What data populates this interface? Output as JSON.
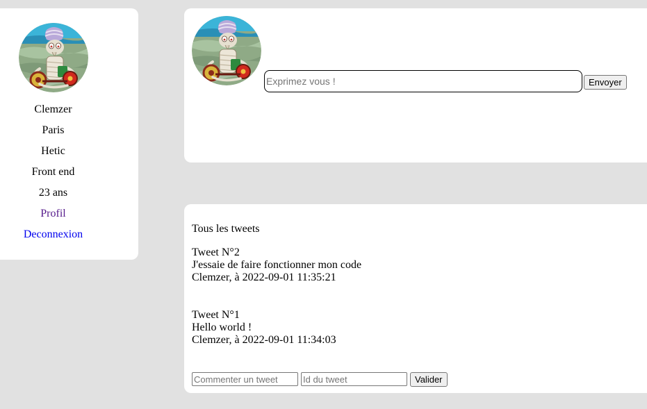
{
  "sidebar": {
    "username": "Clemzer",
    "city": "Paris",
    "school": "Hetic",
    "job": "Front end",
    "age": "23 ans",
    "profile_link": "Profil",
    "logout_link": "Deconnexion"
  },
  "compose": {
    "placeholder": "Exprimez vous !",
    "submit_label": "Envoyer"
  },
  "feed": {
    "title": "Tous les tweets",
    "tweets": [
      {
        "title": "Tweet N°2",
        "content": "J'essaie de faire fonctionner mon code",
        "meta": "Clemzer, à 2022-09-01 11:35:21"
      },
      {
        "title": "Tweet N°1",
        "content": "Hello world !",
        "meta": "Clemzer, à 2022-09-01 11:34:03"
      }
    ],
    "comment_placeholder": "Commenter un tweet",
    "id_placeholder": "Id du tweet",
    "validate_label": "Valider"
  },
  "colors": {
    "page_bg": "#e1e1e1",
    "card_bg": "#ffffff",
    "visited_link": "#551a8b",
    "link": "#0000ee"
  },
  "icons": {
    "avatar": "squidward-mummy-avatar"
  }
}
